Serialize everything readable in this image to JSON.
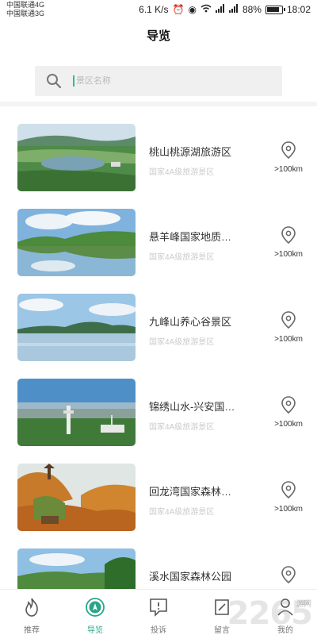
{
  "status_bar": {
    "carrier1": "中国联通4G",
    "carrier2": "中国联通3G",
    "speed": "6.1 K/s",
    "battery": "88%",
    "time": "18:02"
  },
  "header": {
    "title": "导览"
  },
  "search": {
    "placeholder": "景区名称"
  },
  "spots": [
    {
      "name": "桃山桃源湖旅游区",
      "level": "国家4A级旅游景区",
      "distance": ">100km"
    },
    {
      "name": "悬羊峰国家地质公园",
      "level": "国家4A级旅游景区",
      "distance": ">100km"
    },
    {
      "name": "九峰山养心谷景区",
      "level": "国家4A级旅游景区",
      "distance": ">100km"
    },
    {
      "name": "锦绣山水-兴安国家森林公园",
      "level": "国家4A级旅游景区",
      "distance": ">100km"
    },
    {
      "name": "回龙湾国家森林公园",
      "level": "国家4A级旅游景区",
      "distance": ">100km"
    },
    {
      "name": "溪水国家森林公园",
      "level": "",
      "distance": ""
    }
  ],
  "tabs": [
    {
      "label": "推荐",
      "icon": "flame-icon"
    },
    {
      "label": "导览",
      "icon": "compass-icon",
      "active": true
    },
    {
      "label": "投诉",
      "icon": "complaint-icon"
    },
    {
      "label": "留言",
      "icon": "note-icon"
    },
    {
      "label": "我的",
      "icon": "user-icon"
    }
  ],
  "colors": {
    "accent": "#2aa58a",
    "cursor": "#2bbf8f"
  },
  "watermark": {
    "text": "2265",
    "sub": "游网"
  }
}
